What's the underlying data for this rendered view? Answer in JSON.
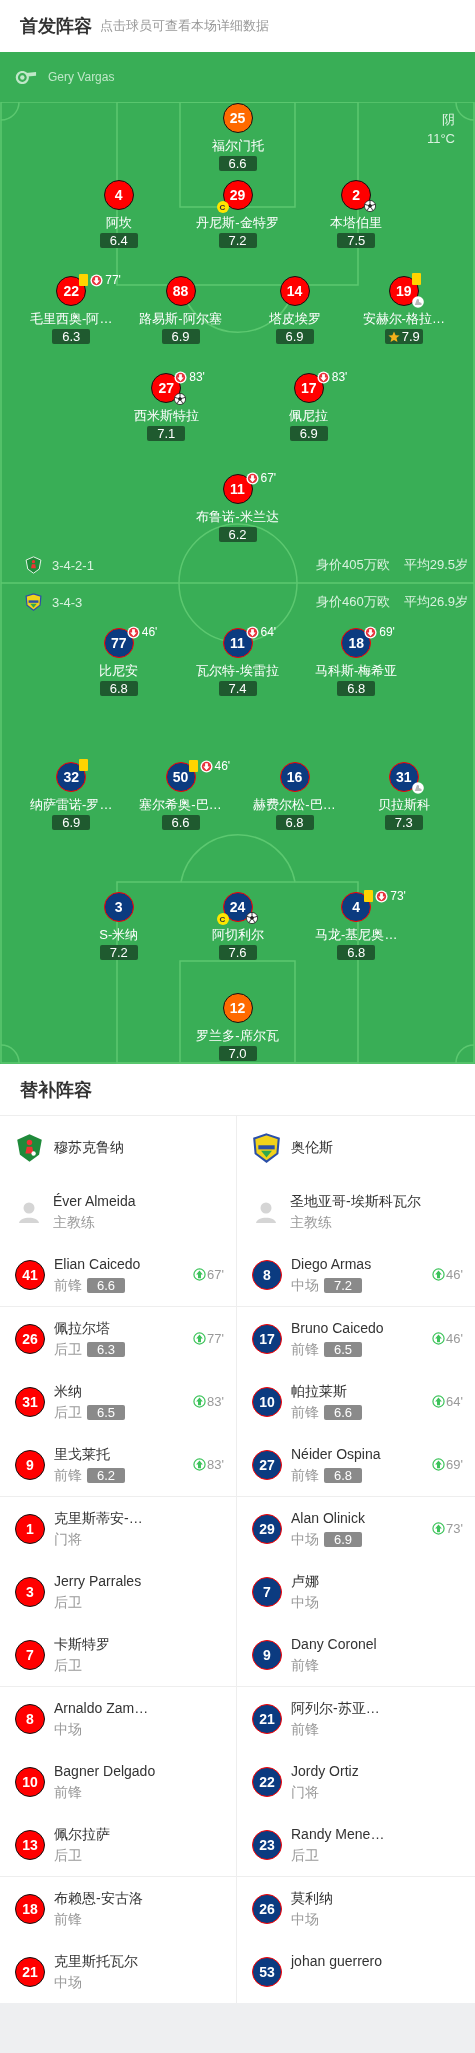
{
  "header": {
    "title": "首发阵容",
    "subtitle": "点击球员可查看本场详细数据"
  },
  "pitch": {
    "referee": "Gery Vargas",
    "weather": {
      "condition": "阴",
      "temperature": "11°C"
    },
    "teams": [
      {
        "kind": "home",
        "formation": "3-4-2-1",
        "market_value": "身价405万欧",
        "average_age": "平均29.5岁",
        "lines": [
          {
            "players": [
              {
                "number": "25",
                "name": "福尔门托",
                "rating": "6.6",
                "kind": "goalkeeper"
              }
            ]
          },
          {
            "players": [
              {
                "number": "4",
                "name": "阿坎",
                "rating": "6.4",
                "kind": "outfield"
              },
              {
                "number": "29",
                "name": "丹尼斯-金特罗",
                "rating": "7.2",
                "kind": "outfield",
                "captain_badge": "C"
              },
              {
                "number": "2",
                "name": "本塔伯里",
                "rating": "7.5",
                "kind": "outfield",
                "goal": true
              }
            ]
          },
          {
            "players": [
              {
                "number": "22",
                "name": "毛里西奥-阿…",
                "rating": "6.3",
                "kind": "outfield",
                "sub_out": "77'",
                "yellow_card": true
              },
              {
                "number": "88",
                "name": "路易斯-阿尔塞",
                "rating": "6.9",
                "kind": "outfield"
              },
              {
                "number": "14",
                "name": "塔皮埃罗",
                "rating": "6.9",
                "kind": "outfield"
              },
              {
                "number": "19",
                "name": "安赫尔-格拉…",
                "rating": "7.9",
                "kind": "outfield",
                "yellow_card": true,
                "assist": true,
                "mvp": true
              }
            ]
          },
          {
            "players": [
              {
                "number": "27",
                "name": "西米斯特拉",
                "rating": "7.1",
                "kind": "outfield",
                "sub_out": "83'",
                "goal": true
              },
              {
                "number": "17",
                "name": "佩尼拉",
                "rating": "6.9",
                "kind": "outfield",
                "sub_out": "83'"
              }
            ]
          },
          {
            "players": [
              {
                "number": "11",
                "name": "布鲁诺-米兰达",
                "rating": "6.2",
                "kind": "outfield",
                "sub_out": "67'"
              }
            ]
          }
        ]
      },
      {
        "kind": "away",
        "formation": "3-4-3",
        "market_value": "身价460万欧",
        "average_age": "平均26.9岁",
        "lines": [
          {
            "players": [
              {
                "number": "77",
                "name": "比尼安",
                "rating": "6.8",
                "kind": "outfield",
                "sub_out": "46'"
              },
              {
                "number": "11",
                "name": "瓦尔特-埃雷拉",
                "rating": "7.4",
                "kind": "outfield",
                "sub_out": "64'"
              },
              {
                "number": "18",
                "name": "马科斯-梅希亚",
                "rating": "6.8",
                "kind": "outfield",
                "sub_out": "69'"
              }
            ]
          },
          {
            "players": [
              {
                "number": "32",
                "name": "纳萨雷诺-罗…",
                "rating": "6.9",
                "kind": "outfield",
                "yellow_card": true
              },
              {
                "number": "50",
                "name": "塞尔希奥-巴…",
                "rating": "6.6",
                "kind": "outfield",
                "sub_out": "46'",
                "yellow_card": true
              },
              {
                "number": "16",
                "name": "赫费尔松-巴…",
                "rating": "6.8",
                "kind": "outfield"
              },
              {
                "number": "31",
                "name": "贝拉斯科",
                "rating": "7.3",
                "kind": "outfield",
                "assist": true
              }
            ]
          },
          {
            "players": [
              {
                "number": "3",
                "name": "S-米纳",
                "rating": "7.2",
                "kind": "outfield"
              },
              {
                "number": "24",
                "name": "阿切利尔",
                "rating": "7.6",
                "kind": "outfield",
                "captain_badge": "C",
                "goal": true
              },
              {
                "number": "4",
                "name": "马龙-基尼奥…",
                "rating": "6.8",
                "kind": "outfield",
                "sub_out": "73'",
                "yellow_card": true
              }
            ]
          },
          {
            "players": [
              {
                "number": "12",
                "name": "罗兰多-席尔瓦",
                "rating": "7.0",
                "kind": "goalkeeper"
              }
            ]
          }
        ]
      }
    ]
  },
  "bench": {
    "title": "替补阵容",
    "teams": [
      {
        "name": "穆苏克鲁纳",
        "coach": "Éver Almeida",
        "coach_role": "主教练"
      },
      {
        "name": "奥伦斯",
        "coach": "圣地亚哥-埃斯科瓦尔",
        "coach_role": "主教练"
      }
    ],
    "groups": [
      [
        {
          "home": {
            "number": "41",
            "name": "Elian Caicedo",
            "position": "前锋",
            "rating": "6.6",
            "sub_in": "67'"
          },
          "away": {
            "number": "8",
            "name": "Diego Armas",
            "position": "中场",
            "rating": "7.2",
            "sub_in": "46'"
          }
        }
      ],
      [
        {
          "home": {
            "number": "26",
            "name": "佩拉尔塔",
            "position": "后卫",
            "rating": "6.3",
            "sub_in": "77'"
          },
          "away": {
            "number": "17",
            "name": "Bruno Caicedo",
            "position": "前锋",
            "rating": "6.5",
            "sub_in": "46'"
          }
        },
        {
          "home": {
            "number": "31",
            "name": "米纳",
            "position": "后卫",
            "rating": "6.5",
            "sub_in": "83'"
          },
          "away": {
            "number": "10",
            "name": "帕拉莱斯",
            "position": "前锋",
            "rating": "6.6",
            "sub_in": "64'"
          }
        },
        {
          "home": {
            "number": "9",
            "name": "里戈莱托",
            "position": "前锋",
            "rating": "6.2",
            "sub_in": "83'"
          },
          "away": {
            "number": "27",
            "name": "Néider Ospina",
            "position": "前锋",
            "rating": "6.8",
            "sub_in": "69'"
          }
        }
      ],
      [
        {
          "home": {
            "number": "1",
            "name": "克里斯蒂安-…",
            "position": "门将"
          },
          "away": {
            "number": "29",
            "name": "Alan Olinick",
            "position": "中场",
            "rating": "6.9",
            "sub_in": "73'"
          }
        },
        {
          "home": {
            "number": "3",
            "name": "Jerry Parrales",
            "position": "后卫"
          },
          "away": {
            "number": "7",
            "name": "卢娜",
            "position": "中场"
          }
        },
        {
          "home": {
            "number": "7",
            "name": "卡斯特罗",
            "position": "后卫"
          },
          "away": {
            "number": "9",
            "name": "Dany Coronel",
            "position": "前锋"
          }
        }
      ],
      [
        {
          "home": {
            "number": "8",
            "name": "Arnaldo Zam…",
            "position": "中场"
          },
          "away": {
            "number": "21",
            "name": "阿列尔-苏亚…",
            "position": "前锋"
          }
        },
        {
          "home": {
            "number": "10",
            "name": "Bagner Delgado",
            "position": "前锋"
          },
          "away": {
            "number": "22",
            "name": "Jordy Ortiz",
            "position": "门将"
          }
        },
        {
          "home": {
            "number": "13",
            "name": "佩尔拉萨",
            "position": "后卫"
          },
          "away": {
            "number": "23",
            "name": "Randy Mene…",
            "position": "后卫"
          }
        }
      ],
      [
        {
          "home": {
            "number": "18",
            "name": "布赖恩-安古洛",
            "position": "前锋"
          },
          "away": {
            "number": "26",
            "name": "莫利纳",
            "position": "中场"
          }
        },
        {
          "home": {
            "number": "21",
            "name": "克里斯托瓦尔",
            "position": "中场"
          },
          "away": {
            "number": "53",
            "name": "johan guerrero"
          }
        }
      ]
    ]
  }
}
